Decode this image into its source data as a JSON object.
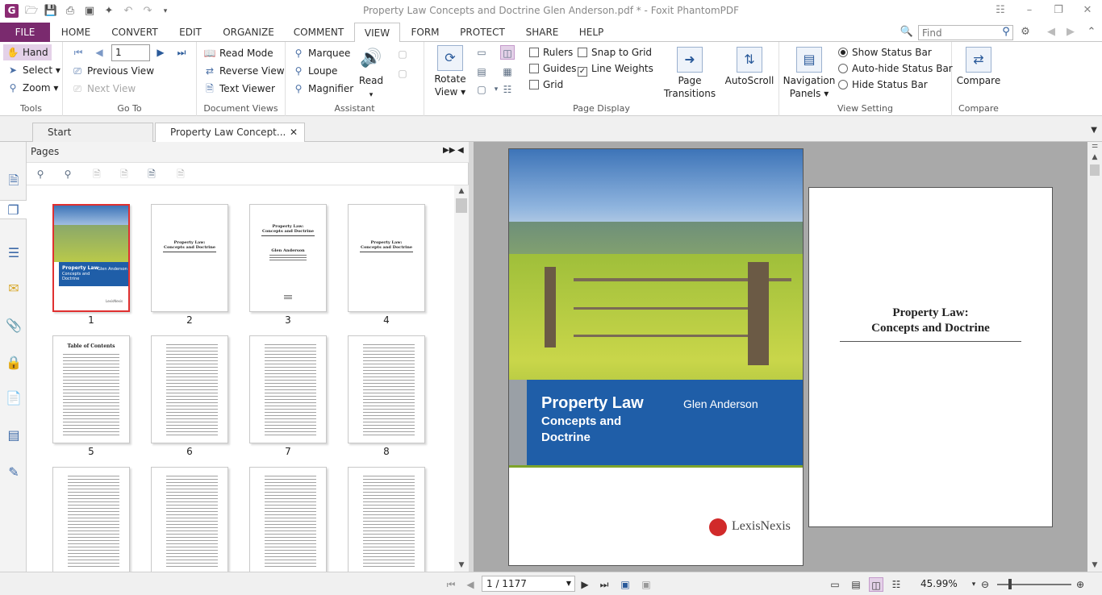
{
  "window": {
    "title": "Property Law Concepts and Doctrine Glen Anderson.pdf * - Foxit PhantomPDF"
  },
  "menu": {
    "tabs": [
      "FILE",
      "HOME",
      "CONVERT",
      "EDIT",
      "ORGANIZE",
      "COMMENT",
      "VIEW",
      "FORM",
      "PROTECT",
      "SHARE",
      "HELP"
    ],
    "active": "VIEW",
    "find_placeholder": "Find"
  },
  "ribbon": {
    "tools": {
      "label": "Tools",
      "hand": "Hand",
      "select": "Select",
      "zoom": "Zoom"
    },
    "goto": {
      "label": "Go To",
      "page_value": "1",
      "previous_view": "Previous View",
      "next_view": "Next View"
    },
    "document_views": {
      "label": "Document Views",
      "read_mode": "Read Mode",
      "reverse_view": "Reverse View",
      "text_viewer": "Text Viewer"
    },
    "assistant": {
      "label": "Assistant",
      "marquee": "Marquee",
      "loupe": "Loupe",
      "magnifier": "Magnifier",
      "read": "Read"
    },
    "page_display": {
      "label": "Page Display",
      "rotate_view_1": "Rotate",
      "rotate_view_2": "View",
      "rulers": "Rulers",
      "guides": "Guides",
      "grid": "Grid",
      "snap_to_grid": "Snap to Grid",
      "line_weights": "Line Weights",
      "page_transitions_1": "Page",
      "page_transitions_2": "Transitions",
      "autoscroll": "AutoScroll"
    },
    "view_setting": {
      "label": "View Setting",
      "navigation_panels_1": "Navigation",
      "navigation_panels_2": "Panels",
      "show_status_bar": "Show Status Bar",
      "autohide_status_bar": "Auto-hide Status Bar",
      "hide_status_bar": "Hide Status Bar"
    },
    "compare": {
      "label": "Compare",
      "compare": "Compare"
    }
  },
  "doc_tabs": {
    "start": "Start",
    "document": "Property Law Concept..."
  },
  "pages_panel": {
    "title": "Pages",
    "thumbnails": [
      {
        "num": "1"
      },
      {
        "num": "2"
      },
      {
        "num": "3"
      },
      {
        "num": "4"
      },
      {
        "num": "5"
      },
      {
        "num": "6"
      },
      {
        "num": "7"
      },
      {
        "num": "8"
      }
    ],
    "thumb_texts": {
      "cover_title": "Property Law",
      "cover_sub": "Concepts and Doctrine",
      "cover_author": "Glen Anderson",
      "cover_brand": "LexisNexis",
      "half_title_1": "Property Law:",
      "half_title_2": "Concepts and Doctrine",
      "title_page_author": "Glen Anderson",
      "toc_title": "Table of Contents"
    }
  },
  "document": {
    "cover": {
      "title": "Property Law",
      "subtitle": "Concepts and Doctrine",
      "author": "Glen Anderson",
      "publisher": "LexisNexis"
    },
    "page2": {
      "line1": "Property Law:",
      "line2": "Concepts and Doctrine"
    }
  },
  "status": {
    "page_indicator": "1 / 1177",
    "zoom": "45.99%"
  }
}
